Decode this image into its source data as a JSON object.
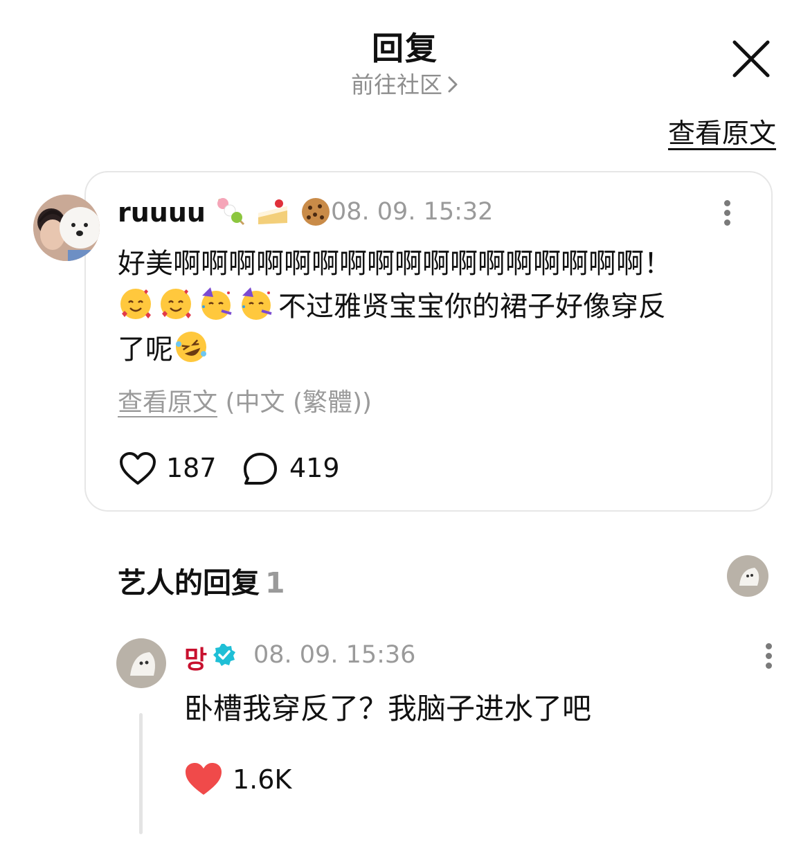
{
  "header": {
    "title": "回复",
    "community_link": "前往社区",
    "close_icon": "close-icon"
  },
  "view_original": "查看原文",
  "comment": {
    "username": "ruuuu",
    "username_emojis": [
      "dango-emoji",
      "cake-emoji",
      "cookie-emoji"
    ],
    "timestamp": "08. 09. 15:32",
    "text_line1": "好美啊啊啊啊啊啊啊啊啊啊啊啊啊啊啊啊啊！",
    "leading_emojis": [
      "smiling-hearts-emoji",
      "smiling-hearts-emoji",
      "partying-face-emoji",
      "partying-face-emoji"
    ],
    "text_line2": "不过雅贤宝宝你的裙子好像穿反",
    "text_line3": "了呢",
    "trailing_emoji": "rofl-emoji",
    "translate_link": "查看原文",
    "translate_lang": "(中文 (繁體))",
    "likes": "187",
    "replies": "419"
  },
  "artist_replies": {
    "title": "艺人的回复",
    "count": "1"
  },
  "reply": {
    "username": "망",
    "verified_icon": "verified-badge-icon",
    "timestamp": "08. 09. 15:36",
    "text": "卧槽我穿反了？我脑子进水了吧",
    "likes": "1.6K"
  },
  "colors": {
    "artist_name": "#c8102e",
    "verified": "#1fbfd6",
    "heart": "#f04a4a",
    "muted": "#9a9a9a"
  }
}
